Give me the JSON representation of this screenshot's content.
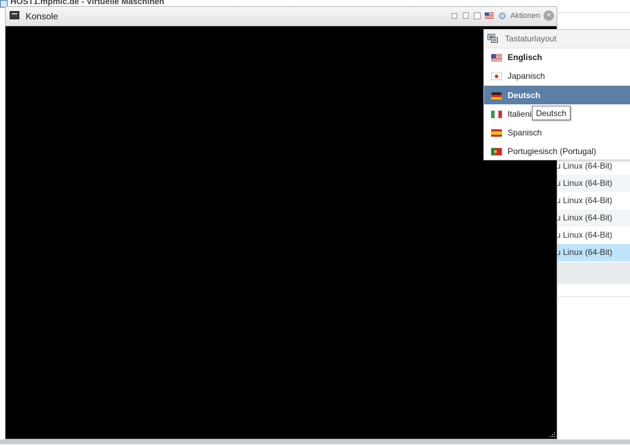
{
  "background_window": {
    "title": "HOST1.mpmic.de - Virtuelle Maschinen",
    "rows": [
      {
        "text": "u Linux (64-Bit)",
        "style": "plain"
      },
      {
        "text": "u Linux (64-Bit)",
        "style": "alt"
      },
      {
        "text": "u Linux (64-Bit)",
        "style": "plain"
      },
      {
        "text": "u Linux (64-Bit)",
        "style": "alt"
      },
      {
        "text": "u Linux (64-Bit)",
        "style": "plain"
      },
      {
        "text": "u Linux (64-Bit)",
        "style": "selected"
      }
    ]
  },
  "console": {
    "title": "Konsole",
    "actions_label": "Aktionen",
    "close_symbol": "×",
    "icons": [
      "console-icon",
      "window-small-icon",
      "window-medium-icon",
      "window-large-icon",
      "us-flag-icon",
      "gear-icon",
      "close-icon",
      "resize-grip-icon"
    ]
  },
  "keyboard_menu": {
    "header": "Tastaturlayout",
    "items": [
      {
        "label": "Englisch",
        "flag": "us",
        "bold": true,
        "active": false
      },
      {
        "label": "Japanisch",
        "flag": "jp",
        "bold": false,
        "active": false
      },
      {
        "label": "Deutsch",
        "flag": "de",
        "bold": false,
        "active": true
      },
      {
        "label": "Italienisch",
        "flag": "it",
        "bold": false,
        "active": false
      },
      {
        "label": "Spanisch",
        "flag": "es",
        "bold": false,
        "active": false
      },
      {
        "label": "Portugiesisch (Portugal)",
        "flag": "pt",
        "bold": false,
        "active": false
      }
    ]
  },
  "tooltip": "Deutsch",
  "colors": {
    "menu_highlight": "#5b7fa5",
    "row_selected": "#bfe3fb",
    "console_screen": "#000000"
  }
}
